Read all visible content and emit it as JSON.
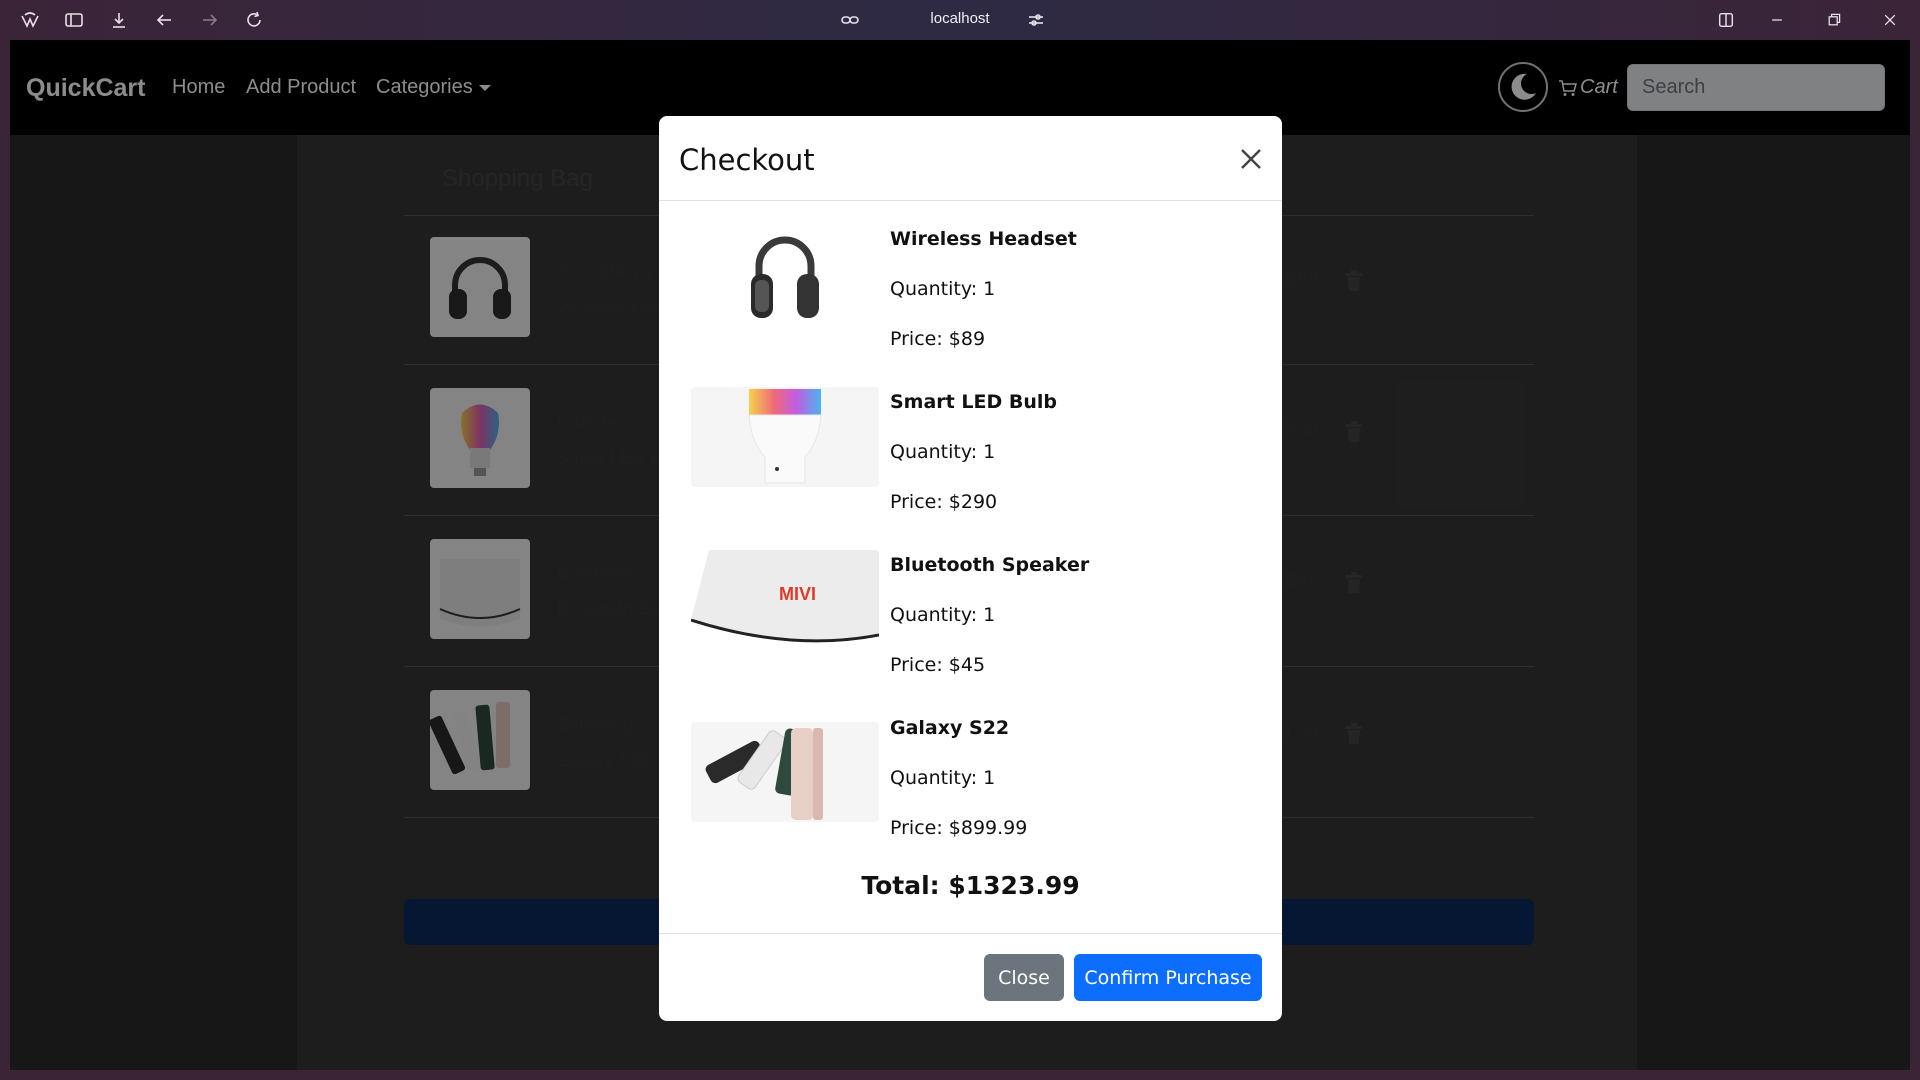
{
  "browser": {
    "url": "localhost"
  },
  "navbar": {
    "brand": "QuickCart",
    "links": [
      "Home",
      "Add Product",
      "Categories"
    ],
    "cart_label": "Cart",
    "search_placeholder": "Search"
  },
  "bag": {
    "title": "Shopping Bag",
    "items": [
      {
        "brand": "SoundNova",
        "name": "Wireless Headset",
        "price": "$89",
        "image": "headphones-image"
      },
      {
        "brand": "GlowTech",
        "name": "Smart LED Bulb",
        "price": "$290",
        "image": "led-bulb-image"
      },
      {
        "brand": "BoomBox",
        "name": "Bluetooth Speaker",
        "price": "$45",
        "image": "speaker-image"
      },
      {
        "brand": "Samsung",
        "name": "Galaxy S22",
        "price": "$899.99",
        "image": "phone-image"
      }
    ]
  },
  "modal": {
    "title": "Checkout",
    "items": [
      {
        "name": "Wireless Headset",
        "quantity": "Quantity: 1",
        "price": "Price: $89"
      },
      {
        "name": "Smart LED Bulb",
        "quantity": "Quantity: 1",
        "price": "Price: $290"
      },
      {
        "name": "Bluetooth Speaker",
        "quantity": "Quantity: 1",
        "price": "Price: $45"
      },
      {
        "name": "Galaxy S22",
        "quantity": "Quantity: 1",
        "price": "Price: $899.99"
      }
    ],
    "total": "Total: $1323.99",
    "close_label": "Close",
    "confirm_label": "Confirm Purchase",
    "speaker_logo": "MIVI"
  },
  "colors": {
    "primary": "#0d6efd",
    "secondary": "#6c757d",
    "navbar": "#000000"
  }
}
